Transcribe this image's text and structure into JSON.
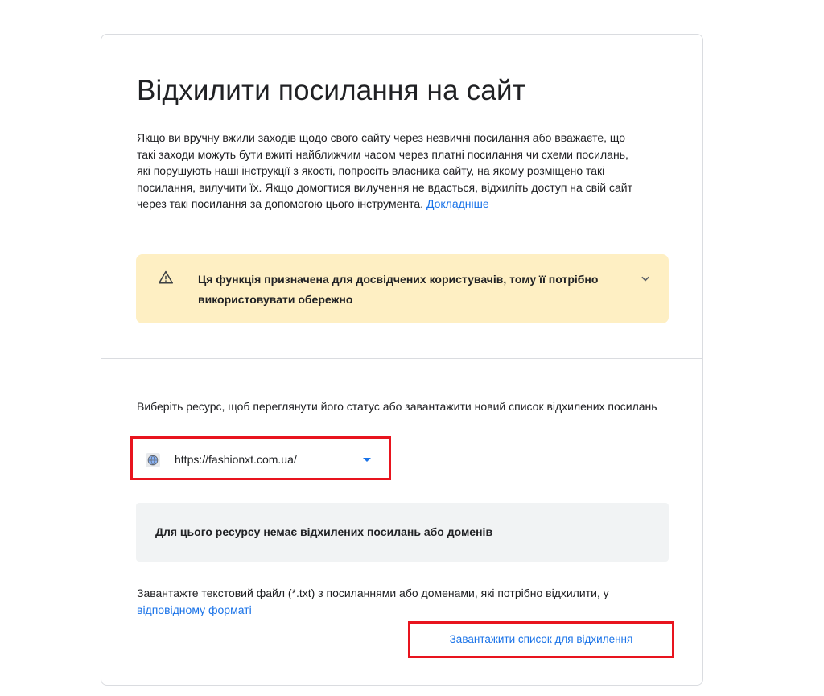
{
  "page": {
    "title": "Відхилити посилання на сайт",
    "intro_text": "Якщо ви вручну вжили заходів щодо свого сайту через незвичні посилання або вважаєте, що такі заходи можуть бути вжиті найближчим часом через платні посилання чи схеми посилань, які порушують наші інструкції з якості, попросіть власника сайту, на якому розміщено такі посилання, вилучити їх. Якщо домогтися вилучення не вдасться, відхиліть доступ на свій сайт через такі посилання за допомогою цього інструмента.",
    "learn_more_link": "Докладніше"
  },
  "warning": {
    "icon": "warning-triangle-icon",
    "text": "Ця функція призначена для досвідчених користувачів, тому її потрібно використовувати обережно",
    "chevron_icon": "chevron-down-icon"
  },
  "property": {
    "label": "Виберіть ресурс, щоб переглянути його статус або завантажити новий список відхилених посилань",
    "selected_value": "https://fashionxt.com.ua/",
    "icon": "globe-icon"
  },
  "status": {
    "text": "Для цього ресурсу немає відхилених посилань або доменів"
  },
  "upload": {
    "description": "Завантажте текстовий файл (*.txt) з посиланнями або доменами, які потрібно відхилити, у",
    "format_link": "відповідному форматі",
    "button_label": "Завантажити список для відхилення"
  },
  "colors": {
    "accent": "#1a73e8",
    "warning_bg": "#feefc3",
    "status_bg": "#f1f3f4",
    "highlight": "#e8141e"
  }
}
